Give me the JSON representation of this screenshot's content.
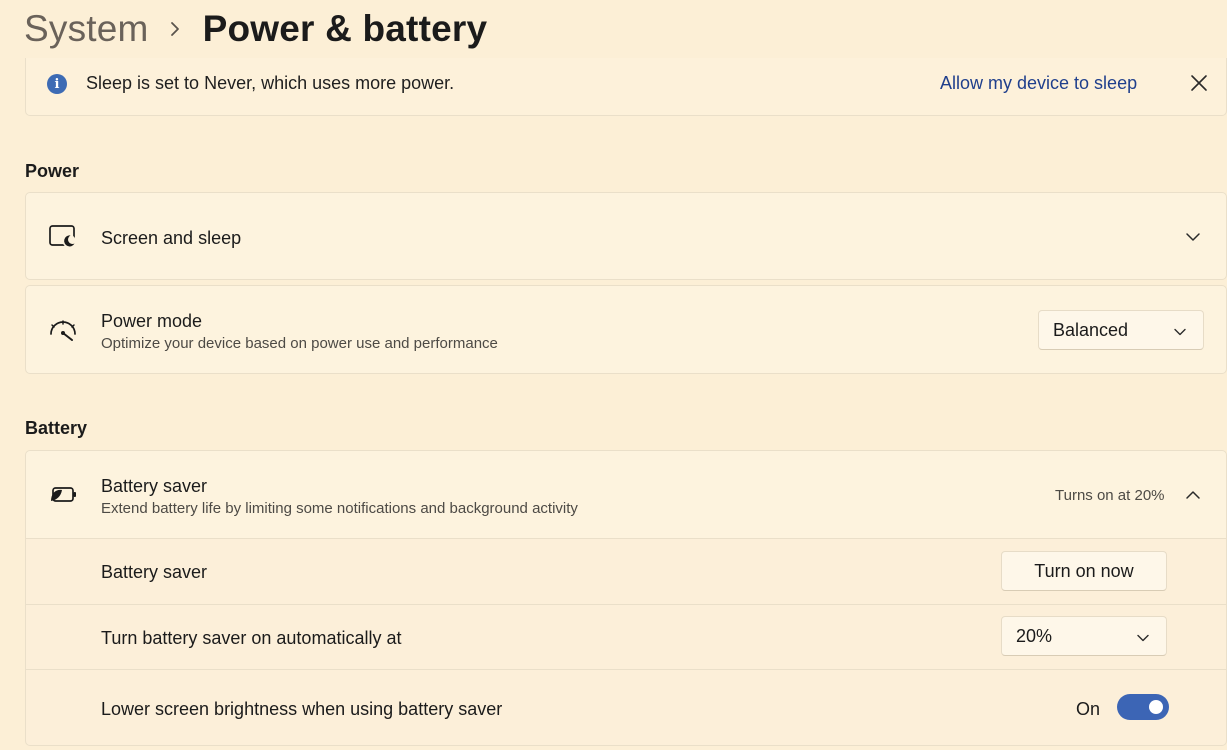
{
  "breadcrumb": {
    "parent": "System",
    "current": "Power & battery"
  },
  "infobar": {
    "icon": "info-icon",
    "icon_glyph": "i",
    "message": "Sleep is set to Never, which uses more power.",
    "link": "Allow my device to sleep",
    "close_icon": "close-icon"
  },
  "power": {
    "heading": "Power",
    "screen_sleep": {
      "title": "Screen and sleep",
      "icon": "screen-sleep-icon",
      "expanded": false
    },
    "power_mode": {
      "title": "Power mode",
      "subtitle": "Optimize your device based on power use and performance",
      "icon": "gauge-icon",
      "selected": "Balanced"
    }
  },
  "battery": {
    "heading": "Battery",
    "saver": {
      "title": "Battery saver",
      "subtitle": "Extend battery life by limiting some notifications and background activity",
      "status": "Turns on at 20%",
      "icon": "battery-leaf-icon",
      "expanded": true
    },
    "rows": {
      "saver_label": "Battery saver",
      "turn_on_button": "Turn on now",
      "auto_label": "Turn battery saver on automatically at",
      "auto_value": "20%",
      "brightness_label": "Lower screen brightness when using battery saver",
      "brightness_state": "On",
      "brightness_on": true
    }
  },
  "colors": {
    "accent": "#3c65b5",
    "link": "#1f3f8c",
    "background": "#fcefd6"
  }
}
